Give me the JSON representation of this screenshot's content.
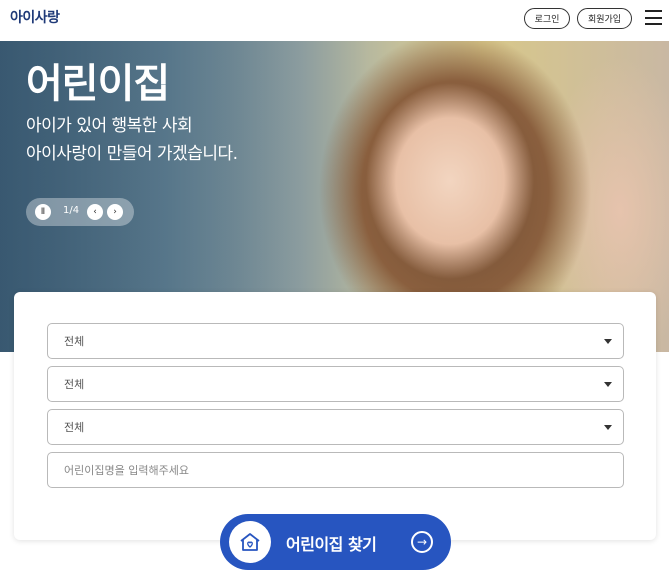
{
  "header": {
    "logo_text": "아이사랑",
    "login_label": "로그인",
    "signup_label": "회원가입",
    "menu_icon": "hamburger-menu-icon"
  },
  "hero": {
    "title": "어린이집",
    "subtitle_line1": "아이가 있어 행복한 사회",
    "subtitle_line2": "아이사랑이 만들어 가겠습니다.",
    "slider": {
      "pause_symbol": "Ⅱ",
      "pager": "1/4",
      "prev_symbol": "‹",
      "next_symbol": "›"
    }
  },
  "search": {
    "selects": [
      {
        "value": "전체"
      },
      {
        "value": "전체"
      },
      {
        "value": "전체"
      }
    ],
    "name_input_placeholder": "어린이집명을 입력해주세요",
    "name_input_value": "",
    "submit_label": "어린이집 찾기",
    "submit_arrow": "→"
  },
  "colors": {
    "brand": "#1f3a78",
    "cta": "#2755c0",
    "border": "#b9b9b9"
  }
}
